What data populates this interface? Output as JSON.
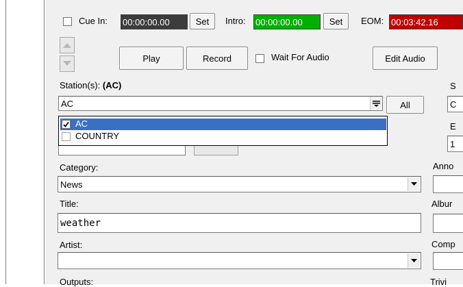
{
  "cue_in": {
    "label": "Cue In:",
    "time": "00:00:00.00",
    "set_label": "Set"
  },
  "intro": {
    "label": "Intro:",
    "time": "00:00:00.00",
    "set_label": "Set"
  },
  "eom": {
    "label": "EOM:",
    "time": "00:03:42.16"
  },
  "transport": {
    "play_label": "Play",
    "record_label": "Record",
    "wait_label": "Wait For Audio",
    "edit_audio_label": "Edit Audio"
  },
  "stations": {
    "label_prefix": "Station(s):",
    "label_value": "(AC)",
    "value": "AC",
    "all_label": "All",
    "options": [
      {
        "label": "AC",
        "checked": true,
        "selected": true
      },
      {
        "label": "COUNTRY",
        "checked": false,
        "selected": false
      }
    ]
  },
  "category": {
    "label": "Category:",
    "value": "News"
  },
  "title": {
    "label": "Title:",
    "value": "weather"
  },
  "artist": {
    "label": "Artist:",
    "value": ""
  },
  "outputs": {
    "label": "Outputs:"
  },
  "right_column": {
    "s_label": "S",
    "s_value": "C",
    "e_label": "E",
    "e_value": "1",
    "anno_label": "Anno",
    "album_label": "Albur",
    "comp_label": "Comp",
    "trivia_label": "Trivi"
  },
  "colors": {
    "intro_bg": "#00b000",
    "eom_bg": "#c00000",
    "cue_bg": "#3c3c3c",
    "selection": "#3a6fc4"
  }
}
